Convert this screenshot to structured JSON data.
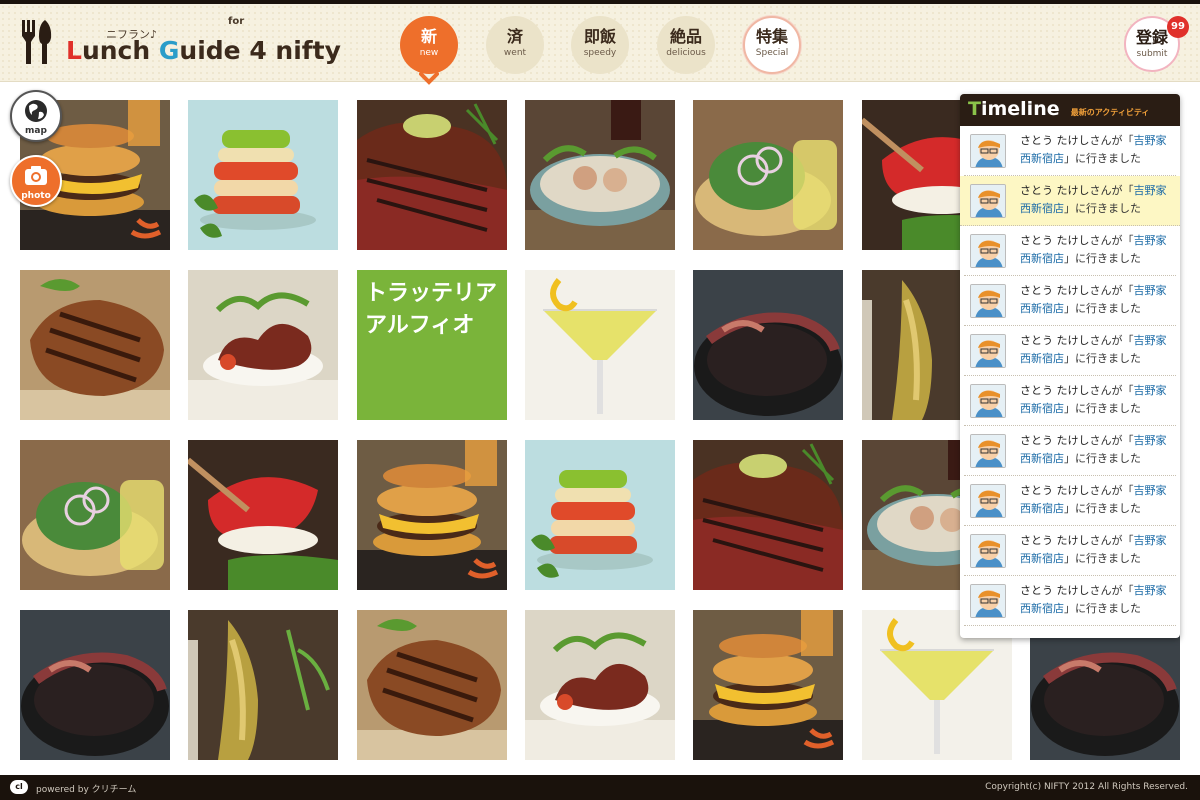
{
  "header": {
    "logo_kana": "ニフラン♪",
    "logo_for": "for",
    "logo_words": [
      "L",
      "unch ",
      "G",
      "uide ",
      "4 ",
      "nifty"
    ],
    "logo_colors": [
      "#e0302a",
      "#3b2a1c",
      "#2a9dc9",
      "#3b2a1c",
      "#3b2a1c",
      "#3b2a1c"
    ],
    "nav": [
      {
        "kanji": "新",
        "sub": "new",
        "active": true
      },
      {
        "kanji": "済",
        "sub": "went"
      },
      {
        "kanji": "即飯",
        "sub": "speedy"
      },
      {
        "kanji": "絶品",
        "sub": "delicious"
      },
      {
        "kanji": "特集",
        "sub": "Special",
        "special": true
      }
    ],
    "submit": {
      "kanji": "登録",
      "sub": "submit",
      "badge": "99"
    }
  },
  "side_buttons": {
    "map": "map",
    "photo": "photo"
  },
  "tiles": [
    {
      "type": "burger"
    },
    {
      "type": "tomato"
    },
    {
      "type": "steak"
    },
    {
      "type": "squid"
    },
    {
      "type": "taco"
    },
    {
      "type": "sushi"
    },
    {
      "type": "chicken"
    },
    {
      "type": "octopus"
    },
    {
      "type": "text",
      "lines": [
        "トラッテリア",
        "アルフィオ"
      ]
    },
    {
      "type": "cocktail"
    },
    {
      "type": "lentil"
    },
    {
      "type": "fish"
    },
    {
      "type": "taco"
    },
    {
      "type": "sushi"
    },
    {
      "type": "burger"
    },
    {
      "type": "tomato"
    },
    {
      "type": "steak"
    },
    {
      "type": "squid"
    },
    {
      "type": "lentil"
    },
    {
      "type": "fish"
    },
    {
      "type": "chicken"
    },
    {
      "type": "octopus"
    },
    {
      "type": "burger"
    },
    {
      "type": "cocktail"
    },
    {
      "type": "lentil"
    }
  ],
  "timeline": {
    "title_first": "T",
    "title_rest": "imeline",
    "subtitle": "最新のアクティビティ",
    "items": [
      {
        "name": "さとう たけし",
        "mid": "さんが「",
        "shop1": "吉野家",
        "shop2": "西新宿店",
        "end": "」に行きました"
      },
      {
        "name": "さとう たけし",
        "mid": "さんが「",
        "shop1": "吉野家",
        "shop2": "西新宿店",
        "end": "」に行きました",
        "highlight": true
      },
      {
        "name": "さとう たけし",
        "mid": "さんが「",
        "shop1": "吉野家",
        "shop2": "西新宿店",
        "end": "」に行きました"
      },
      {
        "name": "さとう たけし",
        "mid": "さんが「",
        "shop1": "吉野家",
        "shop2": "西新宿店",
        "end": "」に行きました"
      },
      {
        "name": "さとう たけし",
        "mid": "さんが「",
        "shop1": "吉野家",
        "shop2": "西新宿店",
        "end": "」に行きました"
      },
      {
        "name": "さとう たけし",
        "mid": "さんが「",
        "shop1": "吉野家",
        "shop2": "西新宿店",
        "end": "」に行きました"
      },
      {
        "name": "さとう たけし",
        "mid": "さんが「",
        "shop1": "吉野家",
        "shop2": "西新宿店",
        "end": "」に行きました"
      },
      {
        "name": "さとう たけし",
        "mid": "さんが「",
        "shop1": "吉野家",
        "shop2": "西新宿店",
        "end": "」に行きました"
      },
      {
        "name": "さとう たけし",
        "mid": "さんが「",
        "shop1": "吉野家",
        "shop2": "西新宿店",
        "end": "」に行きました"
      },
      {
        "name": "さとう たけし",
        "mid": "さんが「",
        "shop1": "吉野家",
        "shop2": "西新宿店",
        "end": "」に行きました"
      }
    ]
  },
  "footer": {
    "logo": "cl",
    "powered": "powered by クリチーム",
    "copyright": "Copyright(c) NIFTY 2012 All Rights Reserved."
  },
  "colors": {
    "accent": "#ee6f2b",
    "dark": "#1a120c",
    "link": "#1a6aa6",
    "green": "#7ab43a"
  }
}
